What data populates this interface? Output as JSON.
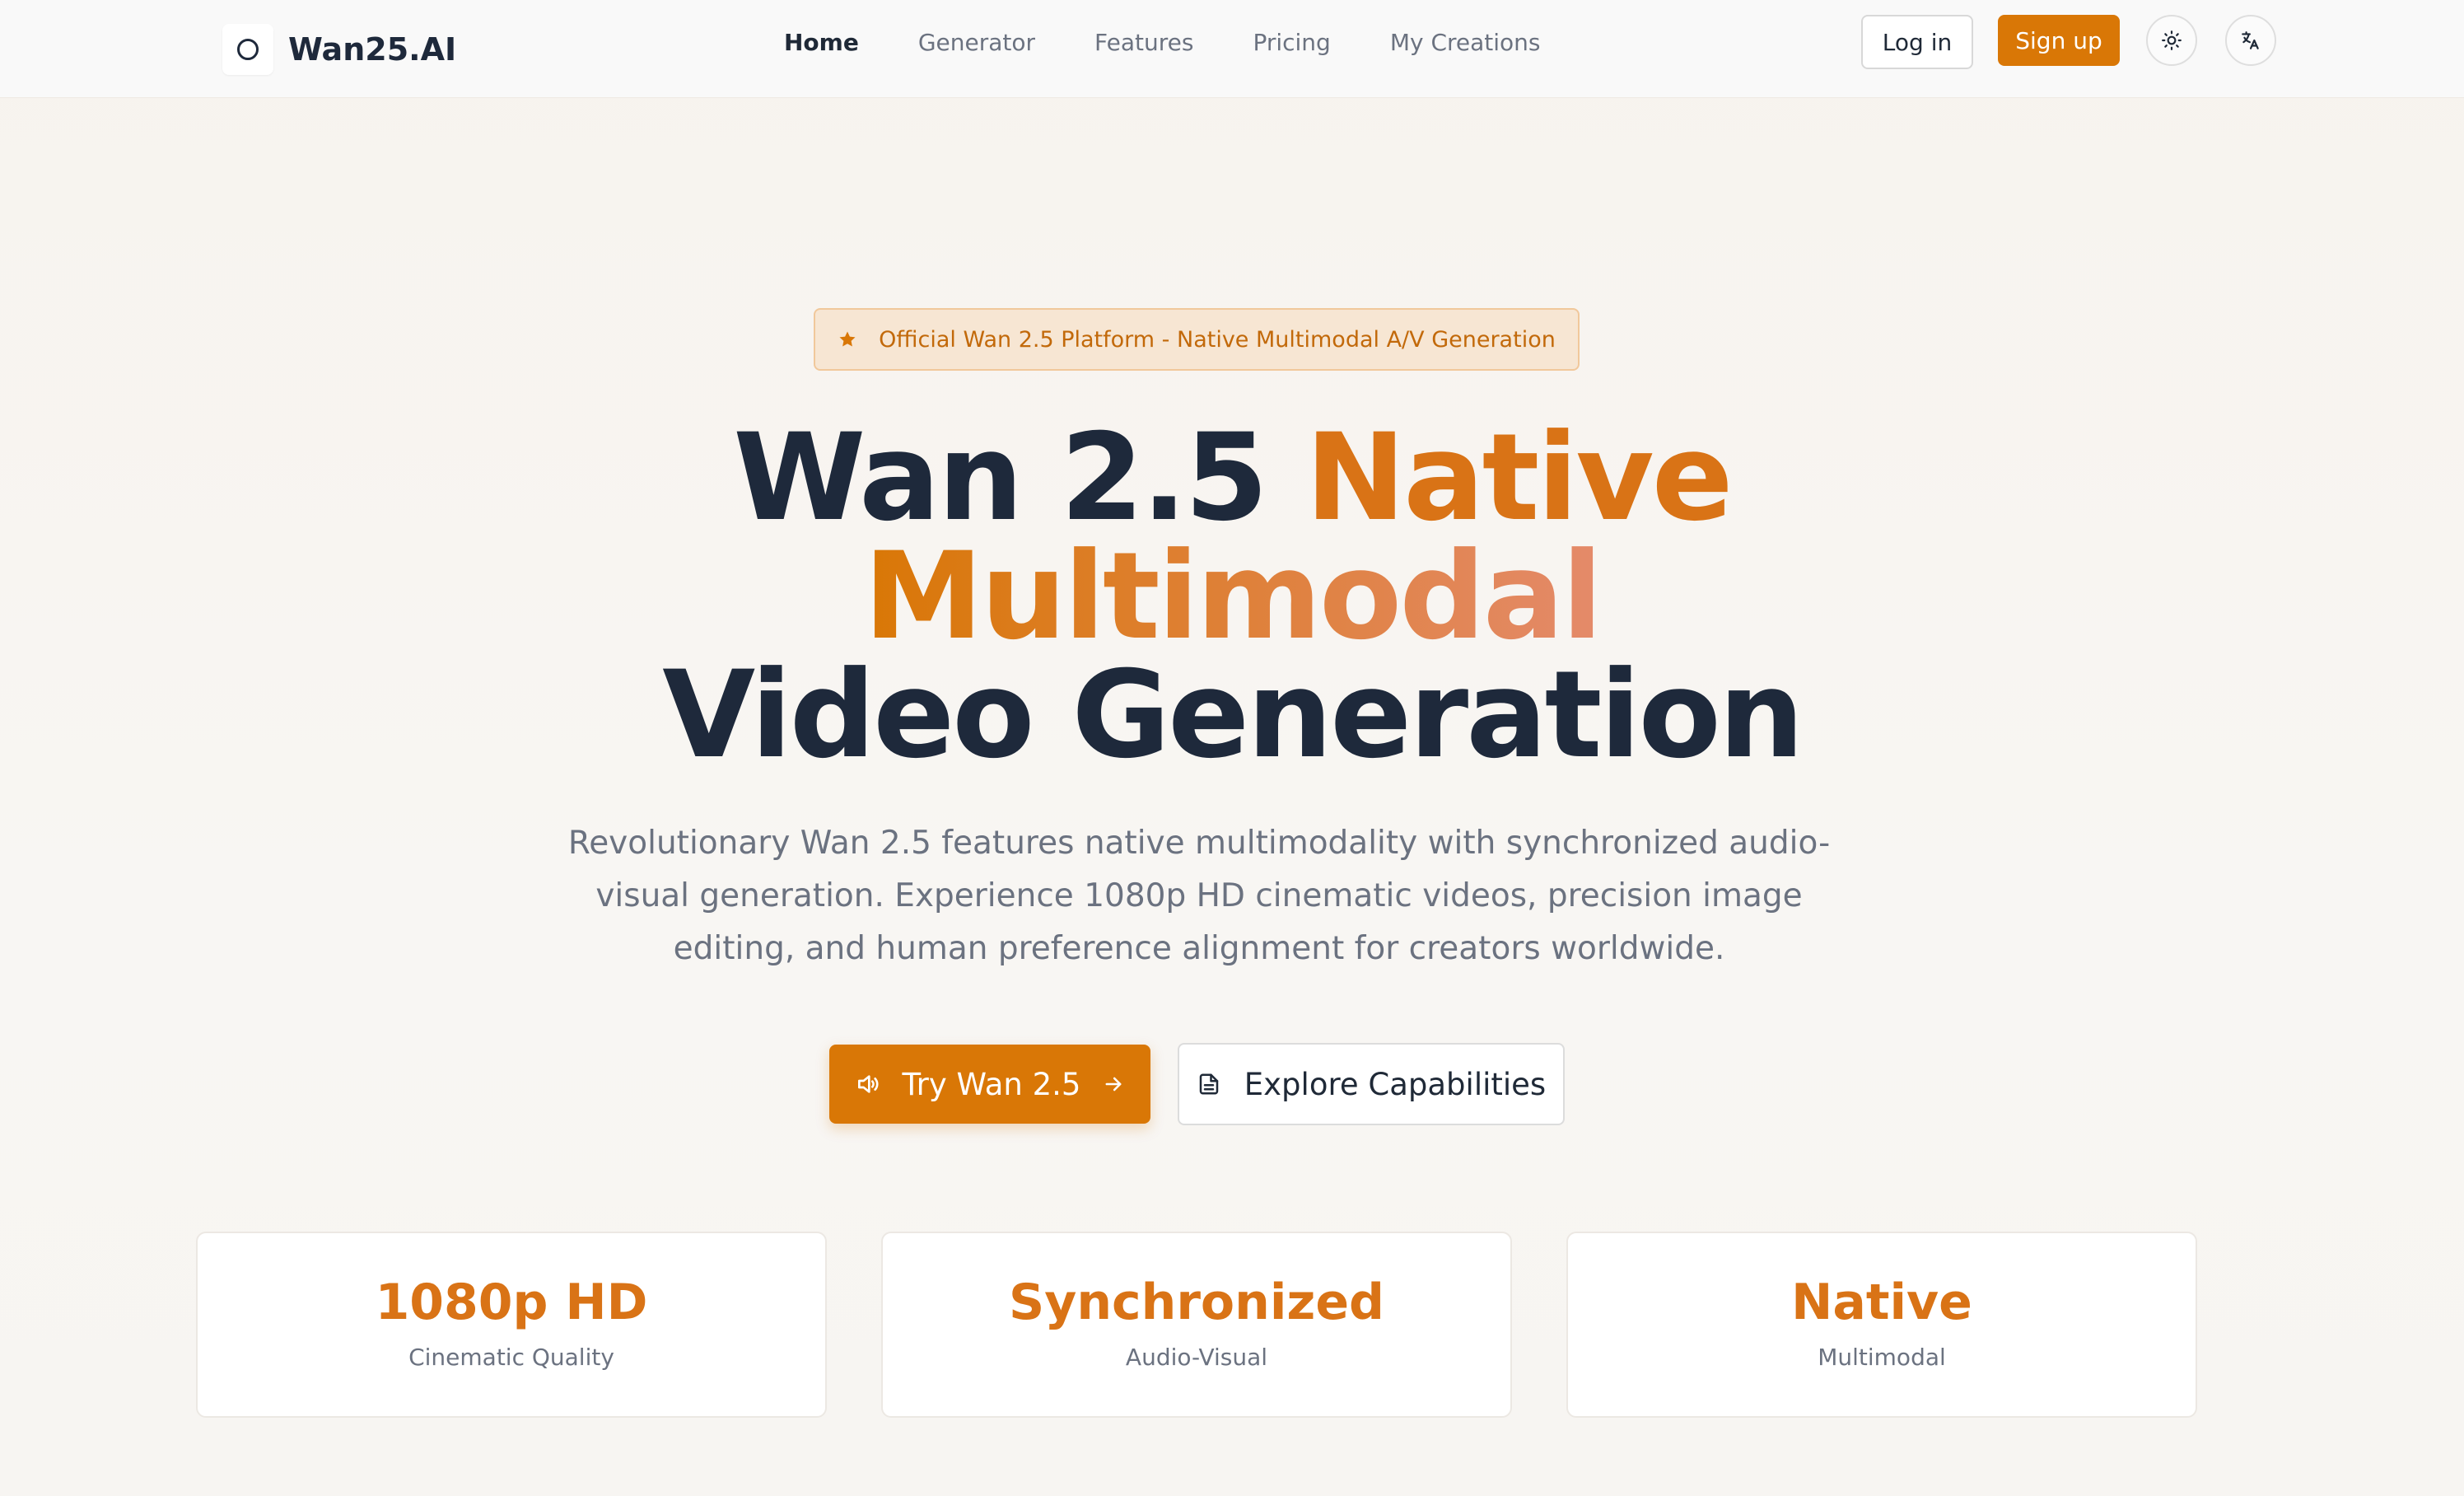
{
  "brand": {
    "name": "Wan25.AI",
    "logo_icon": "circle-logo-icon"
  },
  "nav": {
    "items": [
      {
        "label": "Home",
        "active": true
      },
      {
        "label": "Generator",
        "active": false
      },
      {
        "label": "Features",
        "active": false
      },
      {
        "label": "Pricing",
        "active": false
      },
      {
        "label": "My Creations",
        "active": false
      }
    ]
  },
  "header": {
    "login_label": "Log in",
    "signup_label": "Sign up",
    "theme_icon": "sun-icon",
    "language_icon": "translate-icon"
  },
  "hero": {
    "badge_icon": "star-icon",
    "badge_text": "Official Wan 2.5 Platform - Native Multimodal A/V Generation",
    "title_part1": "Wan 2.5",
    "title_part2": "Native",
    "title_part3": "Multimodal",
    "title_part4": "Video Generation",
    "subtitle_line1": "Revolutionary Wan 2.5 features native multimodality with synchronized audio-",
    "subtitle_line2": "visual generation. Experience 1080p HD cinematic videos, precision image",
    "subtitle_line3": "editing, and human preference alignment for creators worldwide.",
    "try_label": "Try Wan 2.5",
    "explore_label": "Explore Capabilities"
  },
  "stats": [
    {
      "value": "1080p HD",
      "label": "Cinematic Quality"
    },
    {
      "value": "Synchronized",
      "label": "Audio-Visual"
    },
    {
      "value": "Native",
      "label": "Multimodal"
    }
  ],
  "colors": {
    "accent": "#d97706",
    "accent_gradient_end": "#e48a6a",
    "heading": "#1e293b",
    "muted": "#6b7280"
  }
}
